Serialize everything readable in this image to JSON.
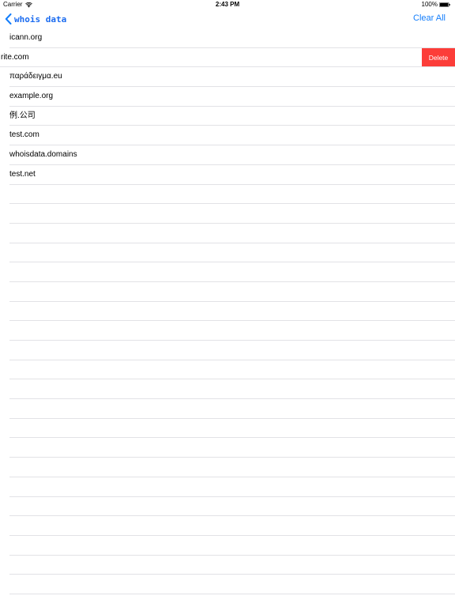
{
  "status_bar": {
    "carrier": "Carrier",
    "time": "2:43 PM",
    "battery": "100%"
  },
  "nav": {
    "back_label": "whois data",
    "clear_all": "Clear All",
    "accent_color": "#147efb"
  },
  "list": {
    "items": [
      {
        "label": "icann.org"
      },
      {
        "label": "rite.com",
        "swiped": true,
        "action": "Delete"
      },
      {
        "label": "παράδειγμα.eu"
      },
      {
        "label": "example.org"
      },
      {
        "label": "例.公司"
      },
      {
        "label": "test.com"
      },
      {
        "label": "whoisdata.domains"
      },
      {
        "label": "test.net"
      }
    ],
    "delete_color": "#fc3d39",
    "empty_rows": 21
  }
}
